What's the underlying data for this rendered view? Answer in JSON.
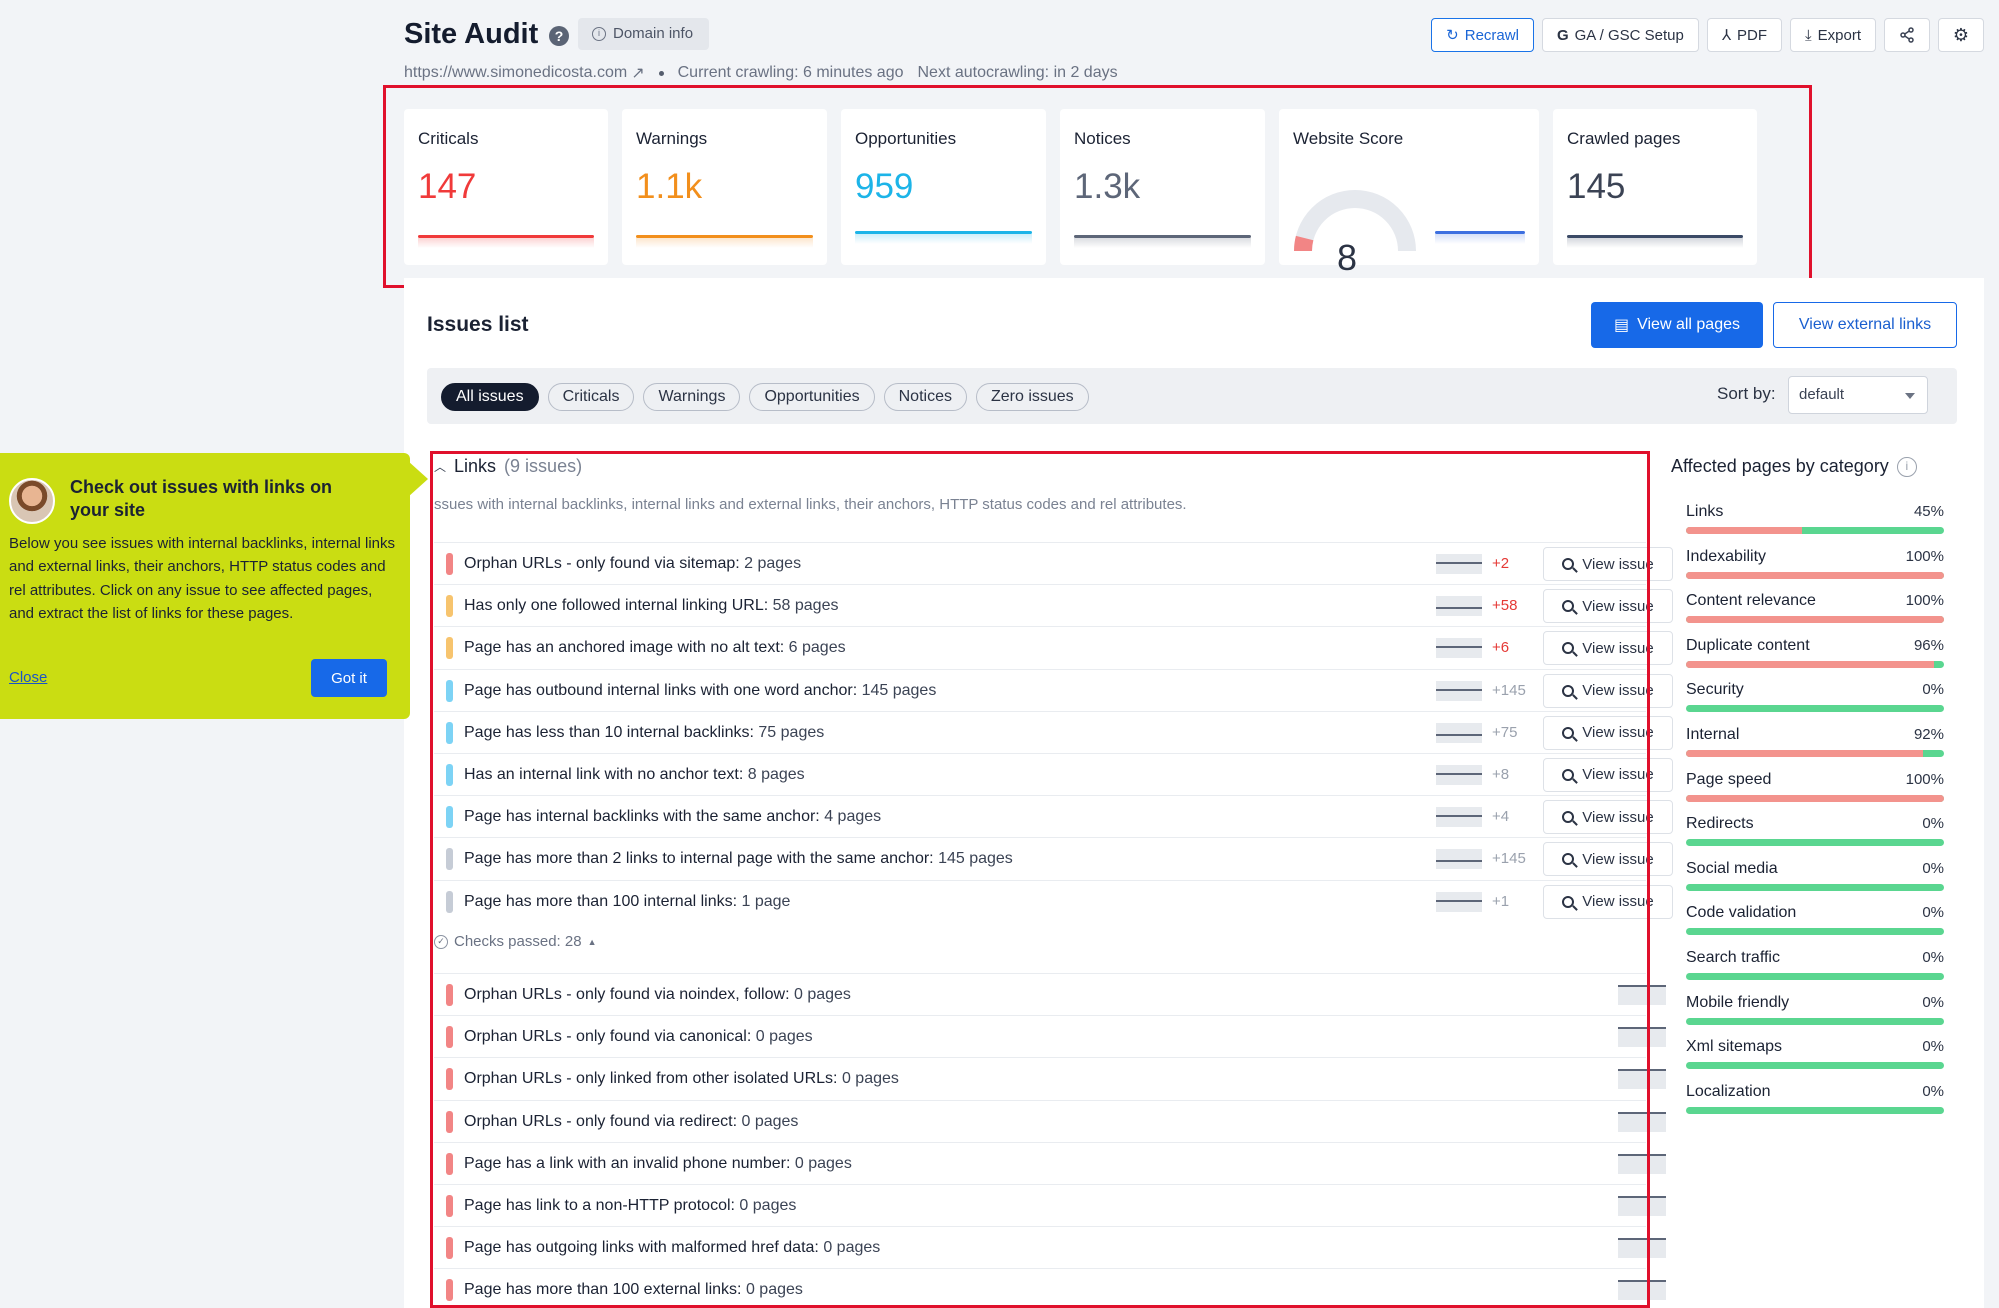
{
  "header": {
    "title": "Site Audit",
    "help_icon": "question-circle-icon",
    "domain_info": "Domain info",
    "buttons": {
      "recrawl": "Recrawl",
      "ga_gsc": "GA / GSC Setup",
      "pdf": "PDF",
      "export": "Export"
    },
    "url": "https://www.simonedicosta.com",
    "current_crawling": "Current crawling: 6 minutes ago",
    "next_autocrawling": "Next autocrawling: in 2 days"
  },
  "stats": {
    "criticals": {
      "label": "Criticals",
      "value": "147",
      "color": "#f03a3a"
    },
    "warnings": {
      "label": "Warnings",
      "value": "1.1k",
      "color": "#f28f1c"
    },
    "opportunities": {
      "label": "Opportunities",
      "value": "959",
      "color": "#1cb4e8"
    },
    "notices": {
      "label": "Notices",
      "value": "1.3k",
      "color": "#5d6678"
    },
    "website_score": {
      "label": "Website Score",
      "value": "8",
      "score_pct": 8
    },
    "crawled_pages": {
      "label": "Crawled pages",
      "value": "145"
    }
  },
  "issues": {
    "title": "Issues list",
    "view_all_pages": "View all pages",
    "view_external_links": "View external links",
    "filters": [
      "All issues",
      "Criticals",
      "Warnings",
      "Opportunities",
      "Notices",
      "Zero issues"
    ],
    "active_filter": "All issues",
    "sort_label": "Sort by:",
    "sort_value": "default"
  },
  "links_section": {
    "title": "Links",
    "count": "(9 issues)",
    "description": "ssues with internal backlinks, internal links and external links, their anchors, HTTP status codes and rel attributes.",
    "view_issue": "View issue",
    "rows": [
      {
        "text": "Orphan URLs - only found via sitemap:",
        "pages": "2 pages",
        "delta": "+2",
        "severity": "#f28585",
        "delta_color": "#e53935"
      },
      {
        "text": "Has only one followed internal linking URL:",
        "pages": "58 pages",
        "delta": "+58",
        "severity": "#f7c46e",
        "delta_color": "#e53935"
      },
      {
        "text": "Page has an anchored image with no alt text:",
        "pages": "6 pages",
        "delta": "+6",
        "severity": "#f7c46e",
        "delta_color": "#e53935"
      },
      {
        "text": "Page has outbound internal links with one word anchor:",
        "pages": "145 pages",
        "delta": "+145",
        "severity": "#7dd3f5",
        "delta_color": "#9aa1ad"
      },
      {
        "text": "Page has less than 10 internal backlinks:",
        "pages": "75 pages",
        "delta": "+75",
        "severity": "#7dd3f5",
        "delta_color": "#9aa1ad"
      },
      {
        "text": "Has an internal link with no anchor text:",
        "pages": "8 pages",
        "delta": "+8",
        "severity": "#7dd3f5",
        "delta_color": "#9aa1ad"
      },
      {
        "text": "Page has internal backlinks with the same anchor:",
        "pages": "4 pages",
        "delta": "+4",
        "severity": "#7dd3f5",
        "delta_color": "#9aa1ad"
      },
      {
        "text": "Page has more than 2 links to internal page with the same anchor:",
        "pages": "145 pages",
        "delta": "+145",
        "severity": "#c6ccd6",
        "delta_color": "#9aa1ad"
      },
      {
        "text": "Page has more than 100 internal links:",
        "pages": "1 page",
        "delta": "+1",
        "severity": "#c6ccd6",
        "delta_color": "#9aa1ad"
      }
    ],
    "checks_passed": "Checks passed: 28",
    "passed_rows": [
      {
        "text": "Orphan URLs - only found via noindex, follow:",
        "pages": "0 pages"
      },
      {
        "text": "Orphan URLs - only found via canonical:",
        "pages": "0 pages"
      },
      {
        "text": "Orphan URLs - only linked from other isolated URLs:",
        "pages": "0 pages"
      },
      {
        "text": "Orphan URLs - only found via redirect:",
        "pages": "0 pages"
      },
      {
        "text": "Page has a link with an invalid phone number:",
        "pages": "0 pages"
      },
      {
        "text": "Page has link to a non-HTTP protocol:",
        "pages": "0 pages"
      },
      {
        "text": "Page has outgoing links with malformed href data:",
        "pages": "0 pages"
      },
      {
        "text": "Page has more than 100 external links:",
        "pages": "0 pages"
      }
    ]
  },
  "affected": {
    "title": "Affected pages by category",
    "categories": [
      {
        "name": "Links",
        "pct": "45%",
        "value": 45
      },
      {
        "name": "Indexability",
        "pct": "100%",
        "value": 100
      },
      {
        "name": "Content relevance",
        "pct": "100%",
        "value": 100
      },
      {
        "name": "Duplicate content",
        "pct": "96%",
        "value": 96
      },
      {
        "name": "Security",
        "pct": "0%",
        "value": 0
      },
      {
        "name": "Internal",
        "pct": "92%",
        "value": 92
      },
      {
        "name": "Page speed",
        "pct": "100%",
        "value": 100
      },
      {
        "name": "Redirects",
        "pct": "0%",
        "value": 0
      },
      {
        "name": "Social media",
        "pct": "0%",
        "value": 0
      },
      {
        "name": "Code validation",
        "pct": "0%",
        "value": 0
      },
      {
        "name": "Search traffic",
        "pct": "0%",
        "value": 0
      },
      {
        "name": "Mobile friendly",
        "pct": "0%",
        "value": 0
      },
      {
        "name": "Xml sitemaps",
        "pct": "0%",
        "value": 0
      },
      {
        "name": "Localization",
        "pct": "0%",
        "value": 0
      }
    ]
  },
  "tooltip": {
    "title": "Check out issues with links on your site",
    "body": "Below you see issues with internal backlinks, internal links and external links, their anchors, HTTP status codes and rel attributes. Click on any issue to see affected pages, and extract the list of links for these pages.",
    "close": "Close",
    "got_it": "Got it"
  }
}
